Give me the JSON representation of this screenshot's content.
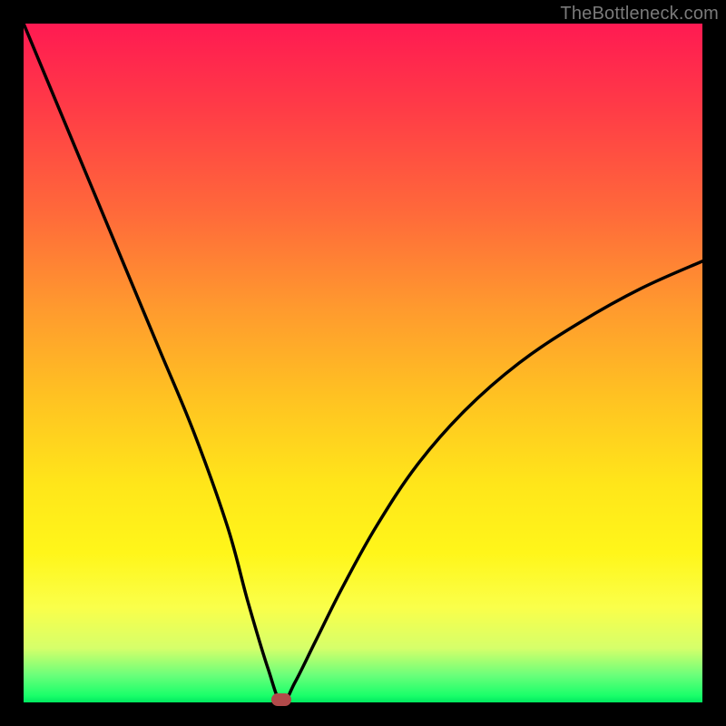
{
  "watermark": "TheBottleneck.com",
  "chart_data": {
    "type": "line",
    "title": "",
    "xlabel": "",
    "ylabel": "",
    "xlim": [
      0,
      100
    ],
    "ylim": [
      0,
      100
    ],
    "grid": false,
    "legend": false,
    "minimum_x": 38,
    "series": [
      {
        "name": "bottleneck-curve",
        "x": [
          0,
          5,
          10,
          15,
          20,
          25,
          30,
          33,
          36,
          38,
          40,
          43,
          47,
          52,
          58,
          65,
          73,
          82,
          91,
          100
        ],
        "values": [
          100,
          88,
          76,
          64,
          52,
          40,
          26,
          15,
          5,
          0,
          3,
          9,
          17,
          26,
          35,
          43,
          50,
          56,
          61,
          65
        ]
      }
    ],
    "marker": {
      "x": 38,
      "y": 0,
      "shape": "pill",
      "color": "#b14a4a"
    },
    "background_gradient": {
      "direction": "top-to-bottom",
      "stops": [
        {
          "pos": 0,
          "color": "#ff1a52"
        },
        {
          "pos": 28,
          "color": "#ff6a3a"
        },
        {
          "pos": 55,
          "color": "#ffc222"
        },
        {
          "pos": 78,
          "color": "#fff61a"
        },
        {
          "pos": 96,
          "color": "#6aff7a"
        },
        {
          "pos": 100,
          "color": "#00e860"
        }
      ]
    }
  }
}
